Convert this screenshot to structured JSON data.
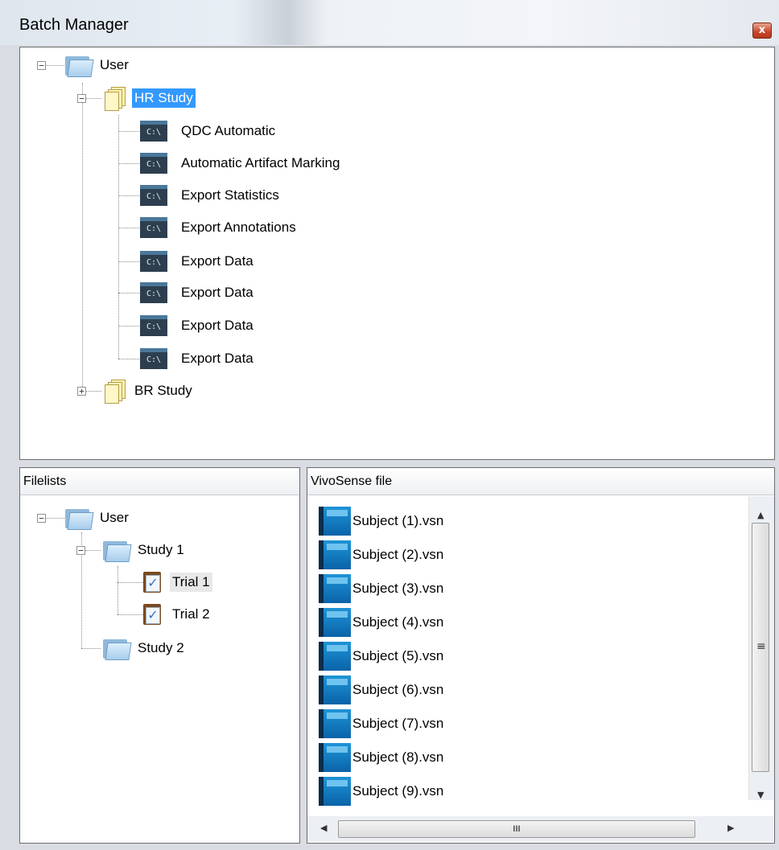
{
  "window": {
    "title": "Batch Manager",
    "close_label": "x"
  },
  "batch_tree": {
    "root": "User",
    "studies": [
      {
        "label": "HR Study",
        "expanded": true,
        "selected": true,
        "items": [
          "QDC Automatic",
          "Automatic Artifact Marking",
          "Export Statistics",
          "Export Annotations",
          "Export Data",
          "Export Data",
          "Export Data",
          "Export Data"
        ]
      },
      {
        "label": "BR Study",
        "expanded": false
      }
    ]
  },
  "filelists": {
    "header": "Filelists",
    "root": "User",
    "studies": [
      {
        "label": "Study 1",
        "trials": [
          "Trial 1",
          "Trial 2"
        ]
      },
      {
        "label": "Study 2"
      }
    ]
  },
  "vivosense": {
    "header": "VivoSense file",
    "files": [
      "Subject (1).vsn",
      "Subject (2).vsn",
      "Subject (3).vsn",
      "Subject (4).vsn",
      "Subject (5).vsn",
      "Subject (6).vsn",
      "Subject (7).vsn",
      "Subject (8).vsn",
      "Subject (9).vsn"
    ],
    "scroll_grip": "≡",
    "hscroll_grip": "III"
  },
  "icons": {
    "command": "C:\\",
    "check": "✓",
    "collapse": "−",
    "expand": "+"
  }
}
